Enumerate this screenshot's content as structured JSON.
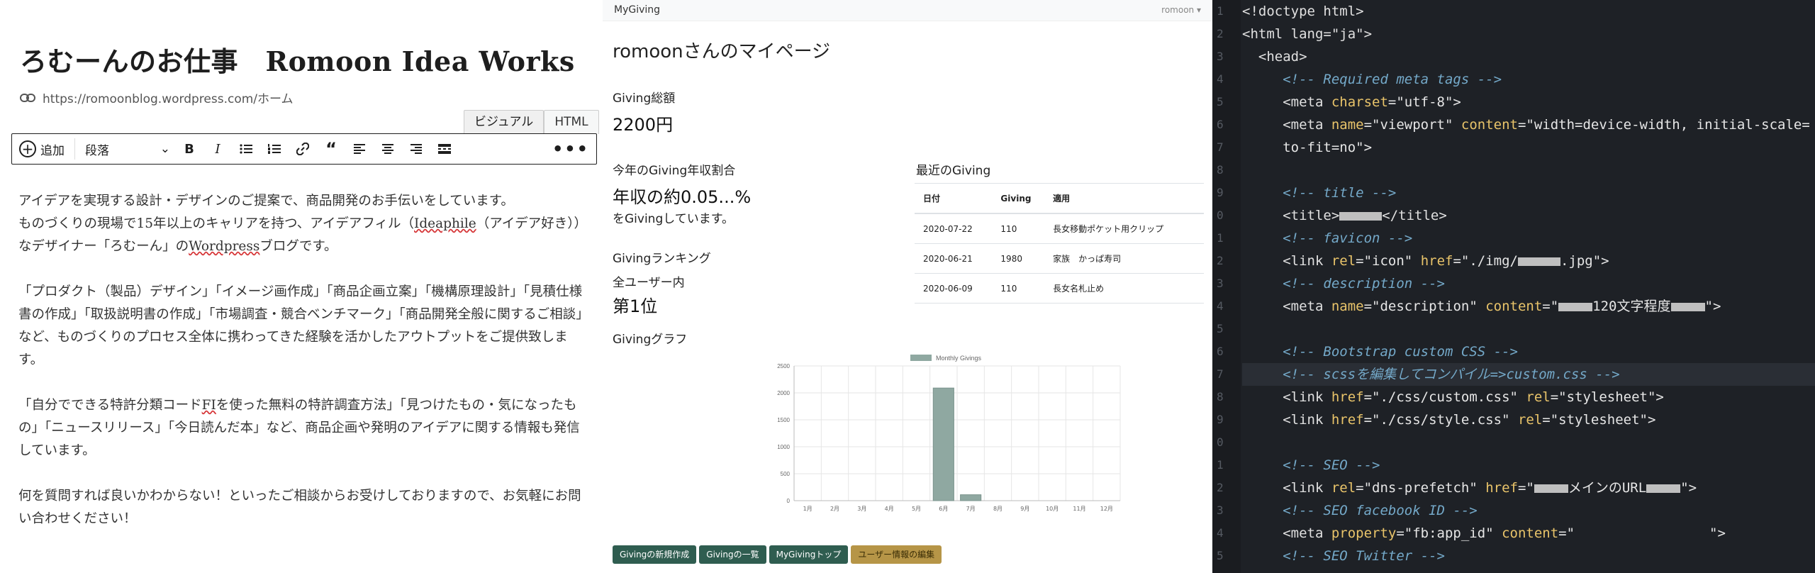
{
  "wp": {
    "title": "ろむーんのお仕事　Romoon Idea Works",
    "permalink": "https://romoonblog.wordpress.com/ホーム",
    "tabs": [
      "ビジュアル",
      "HTML"
    ],
    "toolbar": {
      "add_label": "追加",
      "block_style": "段落"
    },
    "paragraphs": {
      "p1": {
        "a": "アイデアを実現する設計・デザインのご提案で、商品開発のお手伝いをしています。",
        "b": "ものづくりの現場で15年以上のキャリアを持つ、アイデアフィル（",
        "c": "Ideaphile",
        "d": "（アイデア好き））なデザイナー「ろむーん」の",
        "e": "Wordpress",
        "f": "ブログです。"
      },
      "p2": "「プロダクト（製品）デザイン」「イメージ画作成」「商品企画立案」「機構原理設計」「見積仕様書の作成」「取扱説明書の作成」「市場調査・競合ベンチマーク」「商品開発全般に関するご相談」など、ものづくりのプロセス全体に携わってきた経験を活かしたアウトプットをご提供致します。",
      "p3": {
        "a": "「自分でできる特許分類コード",
        "b": "FI",
        "c": "を使った無料の特許調査方法」「見つけたもの・気になったもの」「ニュースリリース」「今日読んだ本」など、商品企画や発明のアイデアに関する情報も発信しています。"
      },
      "p4": "何を質問すれば良いかわからない！といったご相談からお受けしておりますので、お気軽にお問い合わせください！"
    }
  },
  "mygiving": {
    "brand": "MyGiving",
    "user": "romoon ▾",
    "page_title": "romoonさんのマイページ",
    "total_label": "Giving総額",
    "total_value": "2200円",
    "ratio_label": "今年のGiving年収割合",
    "ratio_value": "年収の約0.05...%",
    "ratio_suffix": "をGivingしています。",
    "ranking_label": "Givingランキング",
    "ranking_scope": "全ユーザー内",
    "ranking_value": "第1位",
    "graph_label": "Givingグラフ",
    "recent_label": "最近のGiving",
    "table": {
      "headers": [
        "日付",
        "Giving",
        "適用"
      ],
      "rows": [
        [
          "2020-07-22",
          "110",
          "長女移動ポケット用クリップ"
        ],
        [
          "2020-06-21",
          "1980",
          "家族　かっぱ寿司"
        ],
        [
          "2020-06-09",
          "110",
          "長女名札止め"
        ]
      ]
    },
    "buttons": [
      "Givingの新規作成",
      "Givingの一覧",
      "MyGivingトップ",
      "ユーザー情報の編集"
    ],
    "colors": {
      "primary": "#2f5d50",
      "warning": "#b69547",
      "bar": "#8fa8a1"
    }
  },
  "chart_data": {
    "type": "bar",
    "legend": "Monthly Givings",
    "categories": [
      "1月",
      "2月",
      "3月",
      "4月",
      "5月",
      "6月",
      "7月",
      "8月",
      "9月",
      "10月",
      "11月",
      "12月"
    ],
    "values": [
      0,
      0,
      0,
      0,
      0,
      2090,
      110,
      0,
      0,
      0,
      0,
      0
    ],
    "ylim": [
      0,
      2500
    ],
    "yticks": [
      "0",
      "500",
      "1000",
      "1500",
      "2000",
      "2500"
    ],
    "grid": true,
    "legend_position": "top-center"
  },
  "code": {
    "line_numbers": [
      "1",
      "2",
      "3",
      "4",
      "5",
      "6",
      "7",
      "8",
      "9",
      "0",
      "1",
      "2",
      "3",
      "4",
      "5",
      "6",
      "7",
      "8",
      "9",
      "0",
      "1",
      "2",
      "3",
      "4",
      "5"
    ],
    "lines": {
      "l1": "<!doctype html>",
      "l2": "<html lang=\"ja\">",
      "l3": "<head>",
      "l4": "<!-- Required meta tags -->",
      "l5a": "<meta ",
      "l5b": "charset",
      "l5c": "=\"utf-8\">",
      "l6a": "<meta ",
      "l6b": "name",
      "l6c": "=\"viewport\" ",
      "l6d": "content",
      "l6e": "=\"width=device-width, initial-scale=",
      "l6f": "to-fit=no\">",
      "l8": "<!-- title -->",
      "l9a": "<title>",
      "l9b": "</title>",
      "l10": "<!-- favicon -->",
      "l11a": "<link ",
      "l11b": "rel",
      "l11c": "=\"icon\" ",
      "l11d": "href",
      "l11e": "=\"./img/",
      "l11f": ".jpg\">",
      "l12": "<!-- description -->",
      "l13a": "<meta ",
      "l13b": "name",
      "l13c": "=\"description\" ",
      "l13d": "content",
      "l13e": "=\"",
      "l13f": "120文字程度",
      "l13g": "\">",
      "l15": "<!-- Bootstrap custom CSS -->",
      "l16": "<!-- scssを編集してコンパイル=>custom.css -->",
      "l17a": "<link ",
      "l17b": "href",
      "l17c": "=\"./css/custom.css\" ",
      "l17d": "rel",
      "l17e": "=\"stylesheet\">",
      "l18a": "<link ",
      "l18b": "href",
      "l18c": "=\"./css/style.css\" ",
      "l18d": "rel",
      "l18e": "=\"stylesheet\">",
      "l20": "<!-- SEO -->",
      "l21a": "<link ",
      "l21b": "rel",
      "l21c": "=\"dns-prefetch\" ",
      "l21d": "href",
      "l21e": "=\"",
      "l21f": "メインのURL",
      "l21g": "\">",
      "l22": "<!-- SEO facebook ID -->",
      "l23a": "<meta ",
      "l23b": "property",
      "l23c": "=\"fb:app_id\" ",
      "l23d": "content",
      "l23e": "=\"",
      "l23f": "\">",
      "l24": "<!-- SEO Twitter -->"
    }
  }
}
